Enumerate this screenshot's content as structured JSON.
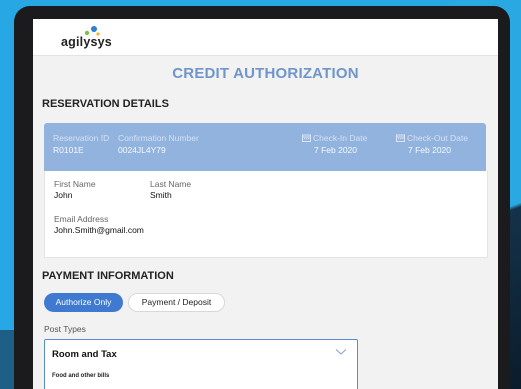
{
  "brand": {
    "logo_text": "agilysys"
  },
  "page": {
    "title": "CREDIT AUTHORIZATION"
  },
  "reservation": {
    "section_title": "RESERVATION DETAILS",
    "bar": {
      "reservation_id_label": "Reservation ID",
      "reservation_id": "R0101E",
      "confirmation_label": "Confirmation Number",
      "confirmation": "0024JL4Y79",
      "checkin_label": "Check-In Date",
      "checkin": "7 Feb 2020",
      "checkout_label": "Check-Out Date",
      "checkout": "7 Feb 2020"
    },
    "guest": {
      "first_name_label": "First Name",
      "first_name": "John",
      "last_name_label": "Last Name",
      "last_name": "Smith",
      "email_label": "Email Address",
      "email": "John.Smith@gmail.com"
    }
  },
  "payment": {
    "section_title": "PAYMENT  INFORMATION",
    "buttons": {
      "authorize_only": "Authorize Only",
      "payment_deposit": "Payment / Deposit"
    },
    "post_types_label": "Post Types",
    "selected_post_type": "Room and Tax",
    "option_preview": "Food and other bills"
  },
  "colors": {
    "background": "#27a7e3",
    "accent": "#3f7ad0",
    "title": "#6f95c9",
    "reservation_bar": "#93b3df"
  },
  "icons": {
    "calendar": "calendar-icon",
    "chevron": "chevron-down-icon"
  }
}
